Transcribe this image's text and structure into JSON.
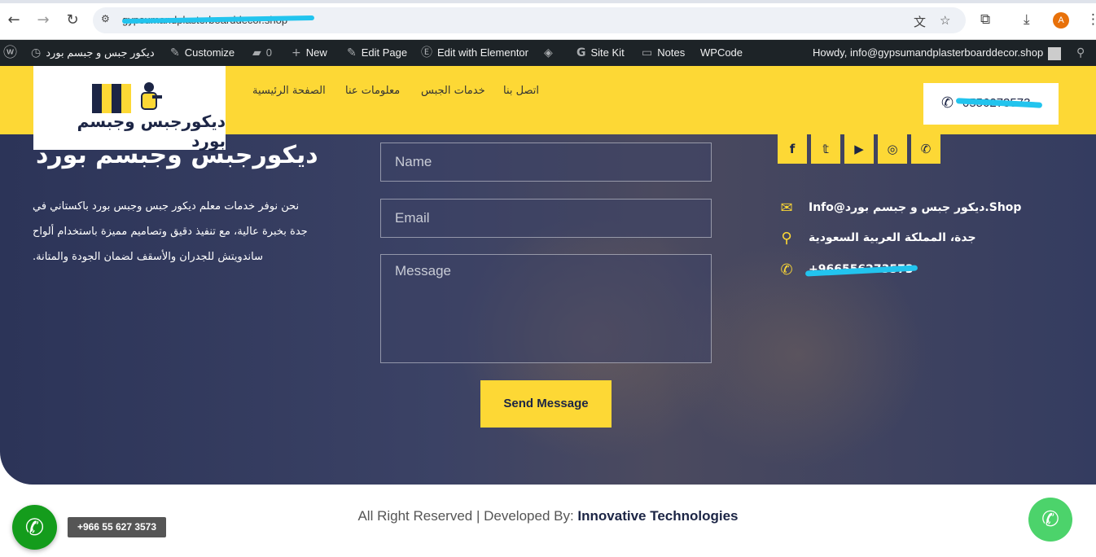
{
  "browser": {
    "url": "gypsumandplasterboarddecor.shop",
    "avatar_letter": "A",
    "icons": [
      "back-icon",
      "forward-icon",
      "reload-icon",
      "site-info-icon",
      "translate-icon",
      "star-icon",
      "extensions-icon",
      "download-icon",
      "menu-icon"
    ]
  },
  "adminbar": {
    "site_name": "ديكور جبس و جبسم بورد",
    "customize": "Customize",
    "comments": "0",
    "new": "New",
    "edit_page": "Edit Page",
    "elementor": "Edit with Elementor",
    "site_kit": "Site Kit",
    "notes": "Notes",
    "wpcode": "WPCode",
    "howdy": "Howdy, info@gypsumandplasterboarddecor.shop"
  },
  "header": {
    "logo_text": "ديكورجبس وجبسم بورد",
    "menu": [
      "الصفحة الرئيسية",
      "معلومات عنا",
      "خدمات الجبس",
      "اتصل بنا"
    ],
    "phone": "0556273573"
  },
  "main": {
    "title": "ديكورجبس وجبسم بورد",
    "about": "نحن نوفر خدمات معلم ديكور جبس وجبس بورد باكستاني في جدة بخبرة عالية، مع تنفيذ دقيق وتصاميم مميزة باستخدام ألواح ساندويتش للجدران والأسقف لضمان الجودة والمتانة.",
    "form": {
      "name_placeholder": "Name",
      "email_placeholder": "Email",
      "message_placeholder": "Message",
      "submit": "Send Message"
    },
    "socials": [
      "facebook-icon",
      "twitter-icon",
      "youtube-icon",
      "instagram-icon",
      "whatsapp-icon"
    ],
    "contact": {
      "email": "Info@ديكور جبس و جبسم بورد.Shop",
      "address": "جدة، المملكة العربية السعودية",
      "phone": "+966556273573"
    }
  },
  "footer": {
    "rights": "All Right Reserved | Developed By: ",
    "developer": "Innovative Technologies"
  },
  "floating": {
    "call_tip": "+966 55 627 3573"
  },
  "colors": {
    "accent": "#fdd835",
    "navy": "#1c2545",
    "call_green": "#149c1c",
    "whatsapp_green": "#4cd36b"
  }
}
